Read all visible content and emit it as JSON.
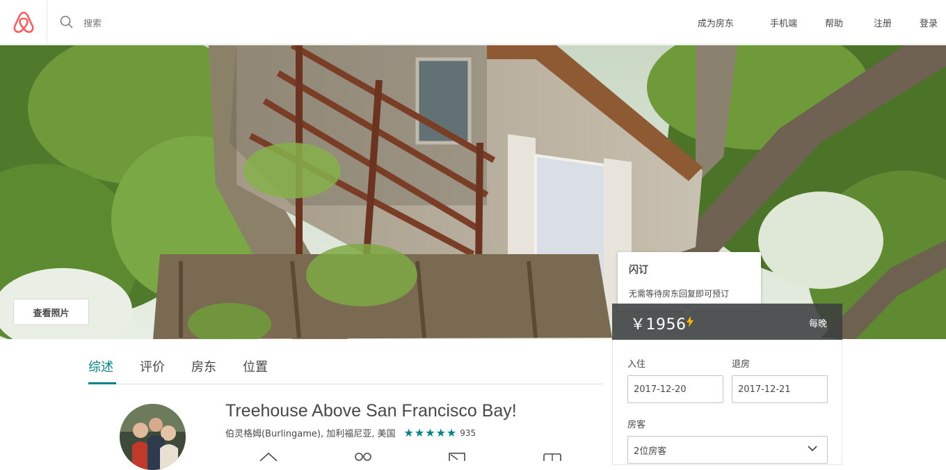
{
  "header": {
    "search_placeholder": "搜索",
    "nav": [
      "成为房东",
      "手机端",
      "帮助",
      "注册",
      "登录"
    ]
  },
  "hero": {
    "view_photos": "查看照片"
  },
  "booking": {
    "tooltip_title": "闪订",
    "tooltip_text": "无需等待房东回复即可预订",
    "price": "￥1956",
    "per_night": "每晚",
    "checkin_label": "入住",
    "checkout_label": "退房",
    "checkin_value": "2017-12-20",
    "checkout_value": "2017-12-21",
    "guests_label": "房客",
    "guests_value": "2位房客"
  },
  "tabs": [
    "综述",
    "评价",
    "房东",
    "位置"
  ],
  "listing": {
    "title": "Treehouse Above San Francisco Bay!",
    "location": "伯灵格姆(Burlingame), 加利福尼亚, 美国",
    "stars": "★★★★★",
    "reviews": "935"
  },
  "colors": {
    "brand": "#FF5A5F",
    "accent": "#008489"
  }
}
